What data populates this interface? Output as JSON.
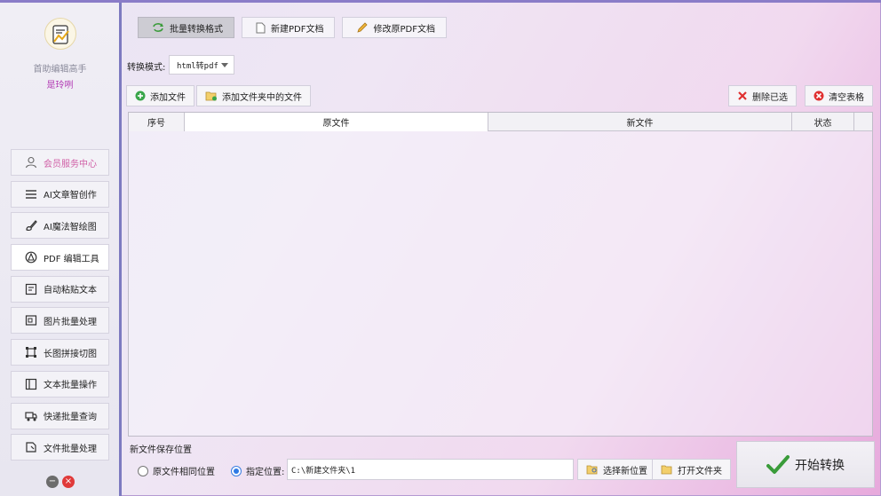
{
  "app": {
    "title": "首助编辑高手",
    "subtitle": "是玲咧"
  },
  "sidebar": {
    "items": [
      {
        "label": "会员服务中心",
        "icon": "user-icon"
      },
      {
        "label": "AI文章智创作",
        "icon": "lines-icon"
      },
      {
        "label": "AI魔法智绘图",
        "icon": "brush-icon"
      },
      {
        "label": "PDF 编辑工具",
        "icon": "pdf-icon"
      },
      {
        "label": "自动粘贴文本",
        "icon": "paste-icon"
      },
      {
        "label": "图片批量处理",
        "icon": "image-icon"
      },
      {
        "label": "长图拼接切图",
        "icon": "crop-icon"
      },
      {
        "label": "文本批量操作",
        "icon": "text-icon"
      },
      {
        "label": "快递批量查询",
        "icon": "truck-icon"
      },
      {
        "label": "文件批量处理",
        "icon": "file-icon"
      }
    ]
  },
  "tabs": [
    {
      "label": "批量转换格式",
      "icon": "convert-icon"
    },
    {
      "label": "新建PDF文档",
      "icon": "doc-icon"
    },
    {
      "label": "修改原PDF文档",
      "icon": "pencil-icon"
    }
  ],
  "mode": {
    "label": "转换模式:",
    "value": "html转pdf"
  },
  "actions": {
    "add_file": "添加文件",
    "add_folder": "添加文件夹中的文件",
    "delete_selected": "删除已选",
    "clear_table": "清空表格"
  },
  "table": {
    "columns": [
      "序号",
      "原文件",
      "新文件",
      "状态"
    ],
    "rows": []
  },
  "save": {
    "title": "新文件保存位置",
    "option_same": "原文件相同位置",
    "option_custom": "指定位置:",
    "path": "C:\\新建文件夹\\1",
    "choose_btn": "选择新位置",
    "open_btn": "打开文件夹"
  },
  "start": {
    "label": "开始转换"
  },
  "colors": {
    "accent": "#7d7ac0",
    "member": "#d05fa6",
    "radio": "#2f7ae5"
  }
}
